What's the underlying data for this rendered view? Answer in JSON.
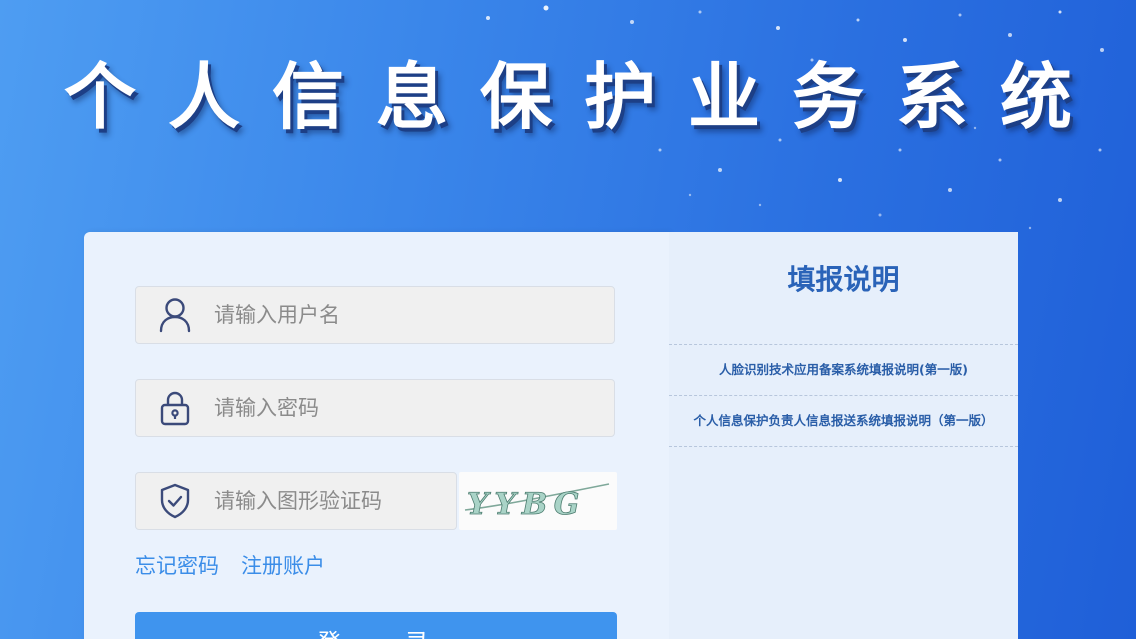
{
  "header": {
    "title": "个人信息保护业务系统"
  },
  "login": {
    "username_placeholder": "请输入用户名",
    "password_placeholder": "请输入密码",
    "captcha_placeholder": "请输入图形验证码",
    "captcha_text": "YYBG",
    "forgot_password": "忘记密码",
    "register": "注册账户",
    "login_button": "登 录"
  },
  "info": {
    "title": "填报说明",
    "items": [
      "人脸识别技术应用备案系统填报说明(第一版)",
      "个人信息保护负责人信息报送系统填报说明（第一版）"
    ]
  },
  "colors": {
    "accent": "#3f94ee",
    "info_title": "#2a63b8",
    "link": "#3b8de8"
  }
}
